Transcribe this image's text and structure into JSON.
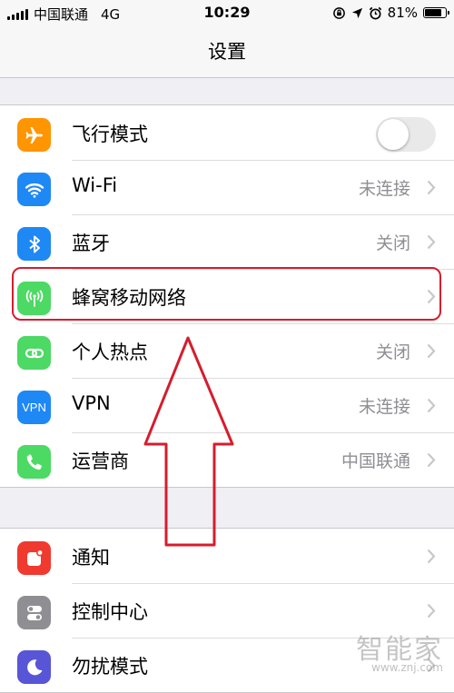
{
  "status_bar": {
    "carrier": "中国联通",
    "network": "4G",
    "time": "10:29",
    "battery": "81%",
    "battery_level": 0.81
  },
  "nav": {
    "title": "设置"
  },
  "group1": [
    {
      "label": "飞行模式",
      "type": "toggle",
      "toggle_on": false,
      "icon": "airplane-icon",
      "color": "#ff9500"
    },
    {
      "label": "Wi-Fi",
      "value": "未连接",
      "icon": "wifi-icon",
      "color": "#1e88f5"
    },
    {
      "label": "蓝牙",
      "value": "关闭",
      "icon": "bluetooth-icon",
      "color": "#1e88f5"
    },
    {
      "label": "蜂窝移动网络",
      "value": "",
      "icon": "cellular-antenna-icon",
      "color": "#4cd964"
    },
    {
      "label": "个人热点",
      "value": "关闭",
      "icon": "hotspot-link-icon",
      "color": "#4cd964"
    },
    {
      "label": "VPN",
      "value": "未连接",
      "icon": "vpn-icon",
      "icon_text": "VPN",
      "color": "#1e88f5"
    },
    {
      "label": "运营商",
      "value": "中国联通",
      "icon": "phone-icon",
      "color": "#4cd964"
    }
  ],
  "group2": [
    {
      "label": "通知",
      "icon": "notifications-icon",
      "color": "#f03a30"
    },
    {
      "label": "控制中心",
      "icon": "control-center-icon",
      "color": "#8e8e93"
    },
    {
      "label": "勿扰模式",
      "icon": "moon-icon",
      "color": "#5856d6"
    }
  ],
  "watermark": {
    "text": "智能家",
    "url": "www.znj.com"
  }
}
